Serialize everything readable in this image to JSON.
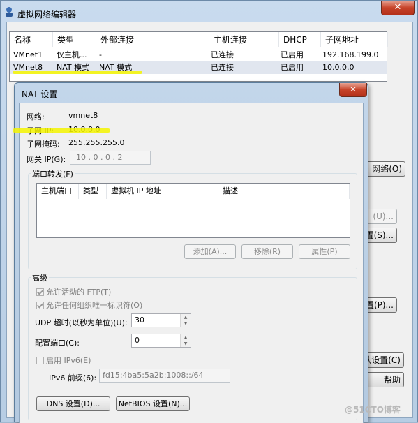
{
  "outer": {
    "title": "虚拟网络编辑器",
    "close": "✕",
    "columns": [
      "名称",
      "类型",
      "外部连接",
      "主机连接",
      "DHCP",
      "子网地址"
    ],
    "rows": [
      {
        "name": "VMnet1",
        "type": "仅主机...",
        "ext": "-",
        "host": "已连接",
        "dhcp": "已启用",
        "subnet": "192.168.199.0"
      },
      {
        "name": "VMnet8",
        "type": "NAT 模式",
        "ext": "NAT 模式",
        "host": "已连接",
        "dhcp": "已启用",
        "subnet": "10.0.0.0"
      }
    ],
    "right_buttons": {
      "remove_network": "网络(O)",
      "btn_u": "(U)...",
      "btn_s": "置(S)...",
      "btn_p": "置(P)...",
      "restore": "认设置(C)",
      "help": "帮助"
    }
  },
  "nat": {
    "title": "NAT 设置",
    "close": "✕",
    "network_label": "网络:",
    "network_value": "vmnet8",
    "subnet_ip_label": "子网 IP:",
    "subnet_ip_value": "10.0.0.0",
    "subnet_mask_label": "子网掩码:",
    "subnet_mask_value": "255.255.255.0",
    "gateway_label": "网关 IP(G):",
    "gateway_value": "10 . 0 . 0 . 2",
    "port_forward_title": "端口转发(F)",
    "port_columns": [
      "主机端口",
      "类型",
      "虚拟机 IP 地址",
      "描述"
    ],
    "add_button": "添加(A)...",
    "remove_button": "移除(R)",
    "props_button": "属性(P)",
    "advanced_title": "高级",
    "allow_ftp": "允许活动的 FTP(T)",
    "allow_uuid": "允许任何组织唯一标识符(O)",
    "udp_timeout_label": "UDP 超时(以秒为单位)(U):",
    "udp_timeout_value": "30",
    "config_port_label": "配置端口(C):",
    "config_port_value": "0",
    "enable_ipv6": "启用 IPv6(E)",
    "ipv6_prefix_label": "IPv6 前缀(6):",
    "ipv6_prefix_value": "fd15:4ba5:5a2b:1008::/64",
    "dns_button": "DNS 设置(D)...",
    "netbios_button": "NetBIOS 设置(N)..."
  },
  "watermark": "@51CTO博客"
}
